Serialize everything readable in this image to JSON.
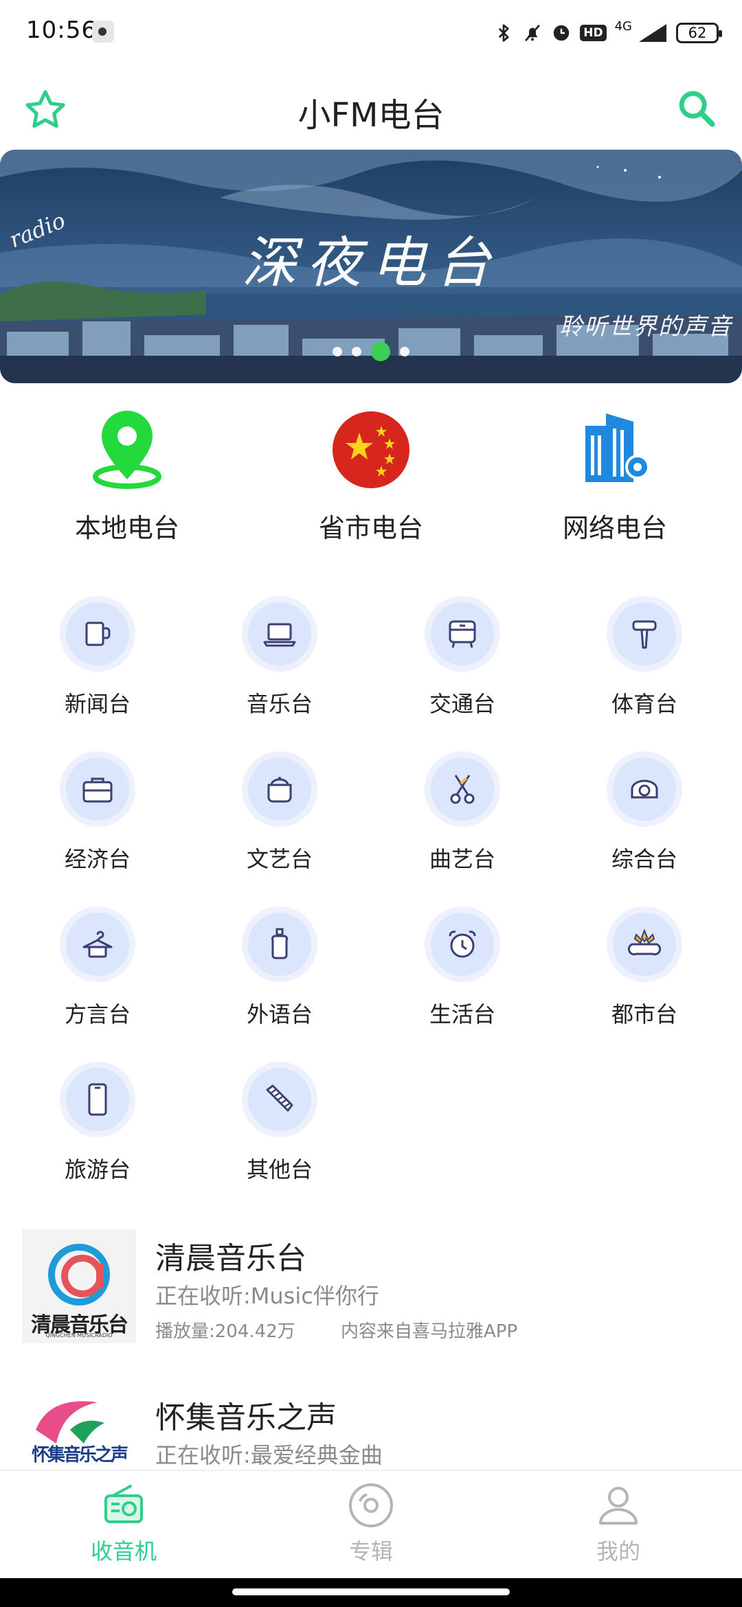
{
  "status": {
    "time": "10:56",
    "network": "4G",
    "hd": "HD",
    "battery": "62"
  },
  "appbar": {
    "title": "小FM电台"
  },
  "banner": {
    "title": "深夜电台",
    "corner_text": "radio",
    "subtitle": "聆听世界的声音",
    "page_count": 4,
    "active_page": 3
  },
  "categories": [
    {
      "label": "本地电台",
      "icon": "location-pin-icon"
    },
    {
      "label": "省市电台",
      "icon": "china-flag-icon"
    },
    {
      "label": "网络电台",
      "icon": "building-gear-icon"
    }
  ],
  "genres": [
    {
      "label": "新闻台",
      "icon": "mug-icon"
    },
    {
      "label": "音乐台",
      "icon": "laptop-icon"
    },
    {
      "label": "交通台",
      "icon": "cabinet-icon"
    },
    {
      "label": "体育台",
      "icon": "hair-dryer-icon"
    },
    {
      "label": "经济台",
      "icon": "briefcase-icon"
    },
    {
      "label": "文艺台",
      "icon": "pot-icon"
    },
    {
      "label": "曲艺台",
      "icon": "scissors-icon"
    },
    {
      "label": "综合台",
      "icon": "sofa-icon"
    },
    {
      "label": "方言台",
      "icon": "hanger-icon"
    },
    {
      "label": "外语台",
      "icon": "bottle-icon"
    },
    {
      "label": "生活台",
      "icon": "alarm-clock-icon"
    },
    {
      "label": "都市台",
      "icon": "plant-pot-icon"
    },
    {
      "label": "旅游台",
      "icon": "phone-icon"
    },
    {
      "label": "其他台",
      "icon": "comb-icon"
    }
  ],
  "stations": [
    {
      "name": "清晨音乐台",
      "now_playing": "正在收听:Music伴你行",
      "plays": "播放量:204.42万",
      "source": "内容来自喜马拉雅APP",
      "logo_text": "清晨音乐台",
      "logo_subtext": "QINGCHEN MUSICRADIO"
    },
    {
      "name": "怀集音乐之声",
      "now_playing": "正在收听:最爱经典金曲",
      "logo_text": "怀集音乐之声"
    }
  ],
  "nav": [
    {
      "label": "收音机",
      "icon": "radio-icon",
      "active": true
    },
    {
      "label": "专辑",
      "icon": "disc-icon",
      "active": false
    },
    {
      "label": "我的",
      "icon": "user-icon",
      "active": false
    }
  ],
  "colors": {
    "accent": "#2ecf8a",
    "nav_inactive": "#b5b5b5",
    "text_secondary": "#8a8a8a",
    "genre_icon_bg": "#dbe5fb",
    "genre_icon_stroke": "#3c3f73"
  }
}
